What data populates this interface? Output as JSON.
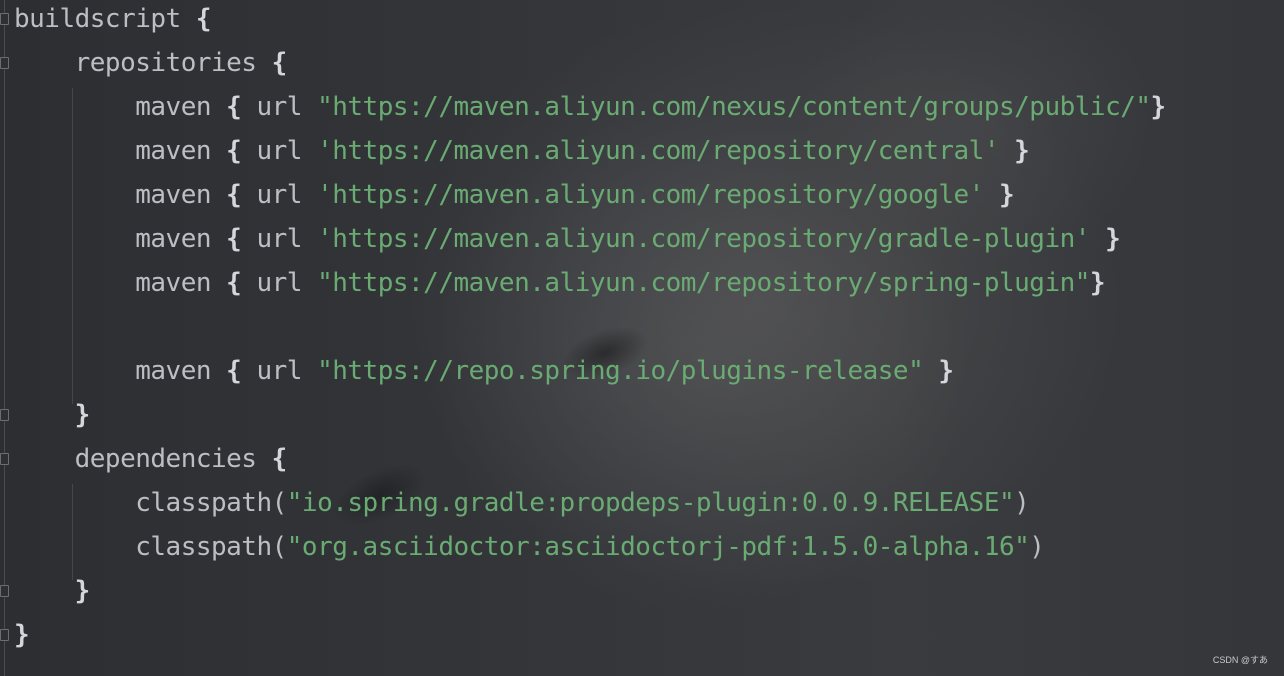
{
  "code": {
    "lines": [
      {
        "indent": "",
        "parts": [
          {
            "t": "buildscript ",
            "c": "kw"
          },
          {
            "t": "{",
            "c": "br"
          }
        ]
      },
      {
        "indent": "    ",
        "parts": [
          {
            "t": "repositories ",
            "c": "kw"
          },
          {
            "t": "{",
            "c": "br"
          }
        ]
      },
      {
        "indent": "        ",
        "parts": [
          {
            "t": "maven ",
            "c": "kw"
          },
          {
            "t": "{",
            "c": "br"
          },
          {
            "t": " url ",
            "c": "kw"
          },
          {
            "t": "\"https://maven.aliyun.com/nexus/content/groups/public/\"",
            "c": "str"
          },
          {
            "t": "}",
            "c": "br"
          }
        ]
      },
      {
        "indent": "        ",
        "parts": [
          {
            "t": "maven ",
            "c": "kw"
          },
          {
            "t": "{",
            "c": "br"
          },
          {
            "t": " url ",
            "c": "kw"
          },
          {
            "t": "'https://maven.aliyun.com/repository/central'",
            "c": "str"
          },
          {
            "t": " }",
            "c": "br"
          }
        ]
      },
      {
        "indent": "        ",
        "parts": [
          {
            "t": "maven ",
            "c": "kw"
          },
          {
            "t": "{",
            "c": "br"
          },
          {
            "t": " url ",
            "c": "kw"
          },
          {
            "t": "'https://maven.aliyun.com/repository/google'",
            "c": "str"
          },
          {
            "t": " }",
            "c": "br"
          }
        ]
      },
      {
        "indent": "        ",
        "parts": [
          {
            "t": "maven ",
            "c": "kw"
          },
          {
            "t": "{",
            "c": "br"
          },
          {
            "t": " url ",
            "c": "kw"
          },
          {
            "t": "'https://maven.aliyun.com/repository/gradle-plugin'",
            "c": "str"
          },
          {
            "t": " }",
            "c": "br"
          }
        ]
      },
      {
        "indent": "        ",
        "parts": [
          {
            "t": "maven ",
            "c": "kw"
          },
          {
            "t": "{",
            "c": "br"
          },
          {
            "t": " url ",
            "c": "kw"
          },
          {
            "t": "\"https://maven.aliyun.com/repository/spring-plugin\"",
            "c": "str"
          },
          {
            "t": "}",
            "c": "br"
          }
        ]
      },
      {
        "indent": "",
        "parts": []
      },
      {
        "indent": "        ",
        "parts": [
          {
            "t": "maven ",
            "c": "kw"
          },
          {
            "t": "{",
            "c": "br"
          },
          {
            "t": " url ",
            "c": "kw"
          },
          {
            "t": "\"https://repo.spring.io/plugins-release\"",
            "c": "str"
          },
          {
            "t": " }",
            "c": "br"
          }
        ]
      },
      {
        "indent": "    ",
        "parts": [
          {
            "t": "}",
            "c": "br"
          }
        ]
      },
      {
        "indent": "    ",
        "parts": [
          {
            "t": "dependencies ",
            "c": "kw"
          },
          {
            "t": "{",
            "c": "br"
          }
        ]
      },
      {
        "indent": "        ",
        "parts": [
          {
            "t": "classpath(",
            "c": "kw"
          },
          {
            "t": "\"io.spring.gradle:propdeps-plugin:0.0.9.RELEASE\"",
            "c": "str"
          },
          {
            "t": ")",
            "c": "kw"
          }
        ]
      },
      {
        "indent": "        ",
        "parts": [
          {
            "t": "classpath(",
            "c": "kw"
          },
          {
            "t": "\"org.asciidoctor:asciidoctorj-pdf:1.5.0-alpha.16\"",
            "c": "str"
          },
          {
            "t": ")",
            "c": "kw"
          }
        ]
      },
      {
        "indent": "    ",
        "parts": [
          {
            "t": "}",
            "c": "br"
          }
        ]
      },
      {
        "indent": "",
        "parts": [
          {
            "t": "}",
            "c": "br"
          }
        ]
      }
    ]
  },
  "watermark": "CSDN @すあ",
  "colors": {
    "background": "#2e3034",
    "text": "#bcbec4",
    "string": "#6aab73",
    "brace": "#d4d6db"
  },
  "icons": [
    "fold-marker-icon"
  ]
}
